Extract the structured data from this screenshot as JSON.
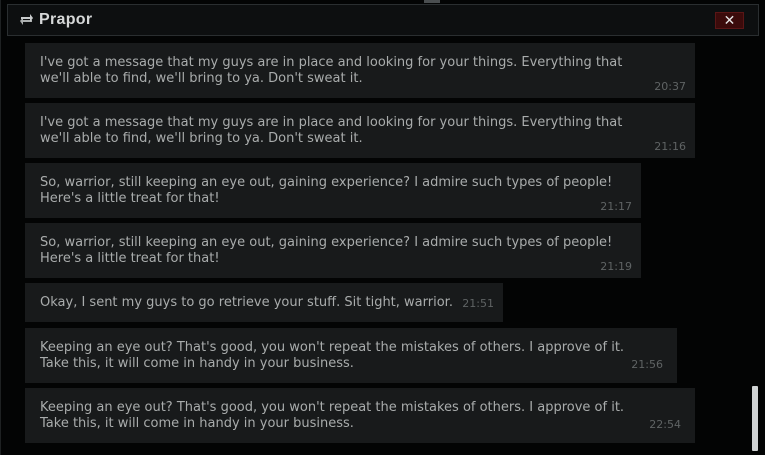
{
  "window": {
    "title": "Prapor",
    "icon": "swap-arrows-icon",
    "close_label": "✕"
  },
  "messages": [
    {
      "text": "I've got a message that my guys are in place and looking for your things. Everything that\nwe'll able to find, we'll bring to ya. Don't sweat it.",
      "time": "20:37"
    },
    {
      "text": "I've got a message that my guys are in place and looking for your things. Everything that\nwe'll able to find, we'll bring to ya. Don't sweat it.",
      "time": "21:16"
    },
    {
      "text": "So, warrior, still keeping an eye out, gaining experience? I admire such types of people!\nHere's a little treat for that!",
      "time": "21:17"
    },
    {
      "text": "So, warrior, still keeping an eye out, gaining experience? I admire such types of people!\nHere's a little treat for that!",
      "time": "21:19"
    },
    {
      "text": "Okay, I sent my guys to go retrieve your stuff. Sit tight, warrior.",
      "time": "21:51"
    },
    {
      "text": "Keeping an eye out? That's good, you won't repeat the mistakes of others. I approve of it.\nTake this, it will come in handy in your business.",
      "time": "21:56"
    },
    {
      "text": "Keeping an eye out? That's good, you won't repeat the mistakes of others. I approve of it.\nTake this, it will come in handy in your business.",
      "time": "22:54"
    }
  ]
}
